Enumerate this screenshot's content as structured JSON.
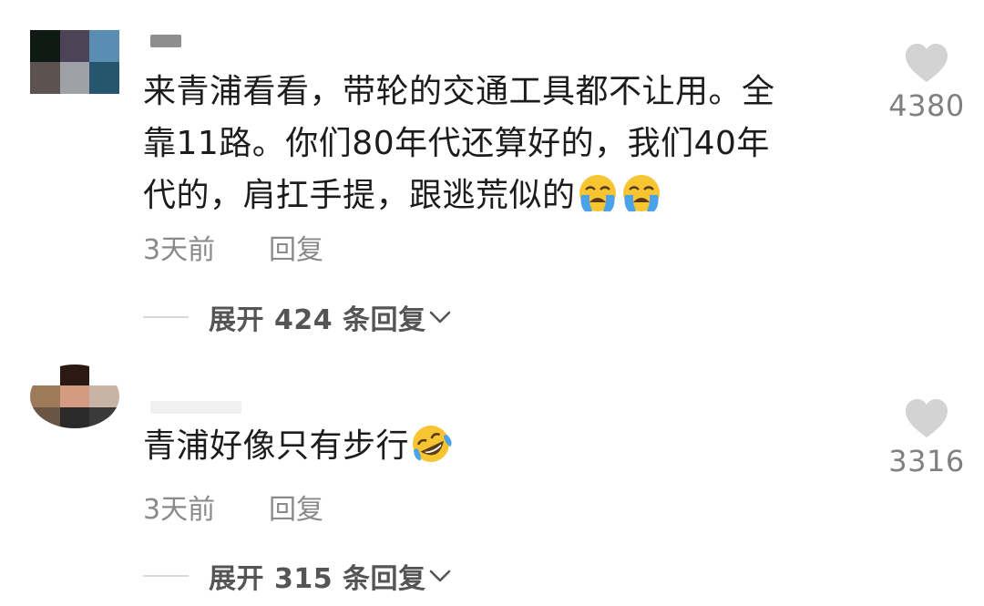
{
  "comments": [
    {
      "text_lines": [
        "来青浦看看，带轮的交通工具都不让用。全",
        "靠11路。你们80年代还算好的，我们40年",
        "代的，肩扛手提，跟逃荒似的"
      ],
      "emoji": [
        "loudly-crying-face",
        "loudly-crying-face"
      ],
      "time": "3天前",
      "reply_label": "回复",
      "expand_label": "展开 424 条回复",
      "like_count": "4380"
    },
    {
      "text_lines": [
        "青浦好像只有步行"
      ],
      "emoji": [
        "rolling-on-floor-laughing-face"
      ],
      "time": "3天前",
      "reply_label": "回复",
      "expand_label": "展开 315 条回复",
      "like_count": "3316"
    }
  ],
  "colors": {
    "text": "#1c1c1c",
    "meta": "#8a8a8a",
    "expand": "#555555",
    "heart": "#d3d3d3",
    "emoji_face": "#f7c531",
    "emoji_tear": "#4aa3e8"
  }
}
